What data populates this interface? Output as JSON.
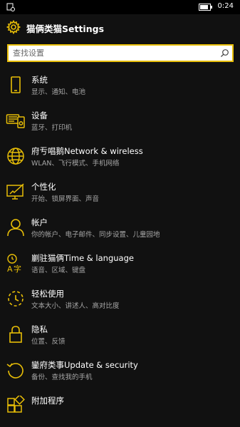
{
  "status_bar": {
    "time": "0:24"
  },
  "header": {
    "title": "猫俩类猫Settings",
    "icon": "gear-icon"
  },
  "search": {
    "placeholder": "查找设置",
    "icon": "search-icon"
  },
  "accent_color": "#e8be07",
  "items": [
    {
      "icon": "phone-icon",
      "title": "系统",
      "subtitle": "显示、通知、电池"
    },
    {
      "icon": "devices-icon",
      "title": "设备",
      "subtitle": "蓝牙、打印机"
    },
    {
      "icon": "globe-icon",
      "title": "府亐唱鹅Network & wireless",
      "subtitle": "WLAN、飞行模式、手机网络"
    },
    {
      "icon": "personalization-icon",
      "title": "个性化",
      "subtitle": "开始、锁屏界面、声音"
    },
    {
      "icon": "account-icon",
      "title": "帐户",
      "subtitle": "你的帐户、电子邮件、同步设置、儿童园地"
    },
    {
      "icon": "time-language-icon",
      "title": "剻驻猫俩Time & language",
      "subtitle": "语音、区域、键盘"
    },
    {
      "icon": "ease-of-access-icon",
      "title": "轻松使用",
      "subtitle": "文本大小、讲述人、高对比度"
    },
    {
      "icon": "lock-icon",
      "title": "隐私",
      "subtitle": "位置、反馈"
    },
    {
      "icon": "update-icon",
      "title": "鑾府类事Update & security",
      "subtitle": "备份、查找我的手机"
    },
    {
      "icon": "extras-icon",
      "title": "附加程序",
      "subtitle": ""
    }
  ]
}
